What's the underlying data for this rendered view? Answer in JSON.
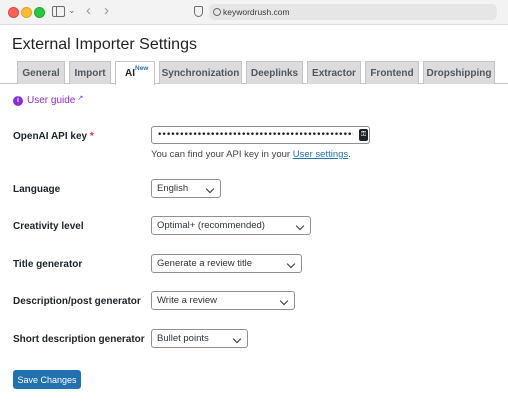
{
  "browser": {
    "url": "keywordrush.com"
  },
  "page": {
    "title": "External Importer Settings"
  },
  "tabs": [
    {
      "label": "General"
    },
    {
      "label": "Import"
    },
    {
      "label": "AI",
      "badge": "New",
      "active": true
    },
    {
      "label": "Synchronization"
    },
    {
      "label": "Deeplinks"
    },
    {
      "label": "Extractor"
    },
    {
      "label": "Frontend"
    },
    {
      "label": "Dropshipping"
    }
  ],
  "guide": {
    "label": "User guide"
  },
  "fields": {
    "api_key": {
      "label": "OpenAI API key",
      "required_mark": "*",
      "value": "••••••••••••••••••••••••••••••••••••••••••••••••••••",
      "hint_prefix": "You can find your API key in your ",
      "hint_link": "User settings",
      "hint_suffix": "."
    },
    "language": {
      "label": "Language",
      "value": "English"
    },
    "creativity": {
      "label": "Creativity level",
      "value": "Optimal+ (recommended)"
    },
    "title_generator": {
      "label": "Title generator",
      "value": "Generate a review title"
    },
    "description_generator": {
      "label": "Description/post generator",
      "value": "Write a review"
    },
    "short_description_generator": {
      "label": "Short description generator",
      "value": "Bullet points"
    }
  },
  "actions": {
    "save_label": "Save Changes"
  },
  "colors": {
    "accent": "#2271b1",
    "guide_link": "#8a2be2",
    "required": "#d63638"
  }
}
